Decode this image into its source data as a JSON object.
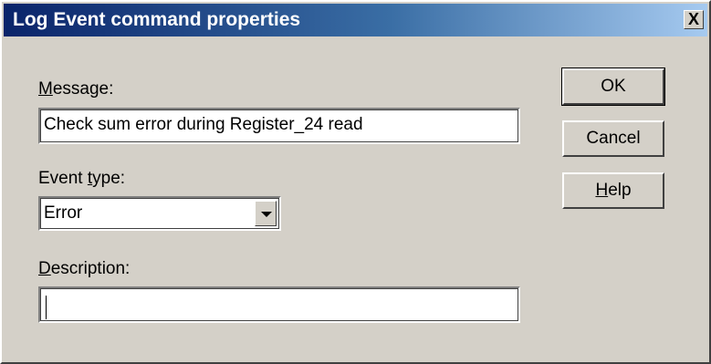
{
  "window": {
    "title": "Log Event command properties",
    "close_label": "X"
  },
  "form": {
    "message": {
      "label_access_key": "M",
      "label_rest": "essage:",
      "value": "Check sum error during Register_24 read"
    },
    "event_type": {
      "label_pre": "Event ",
      "label_access_key": "t",
      "label_rest": "ype:",
      "selected": "Error"
    },
    "description": {
      "label_access_key": "D",
      "label_rest": "escription:",
      "value": ""
    }
  },
  "buttons": {
    "ok": "OK",
    "cancel": "Cancel",
    "help_access_key": "H",
    "help_rest": "elp"
  }
}
